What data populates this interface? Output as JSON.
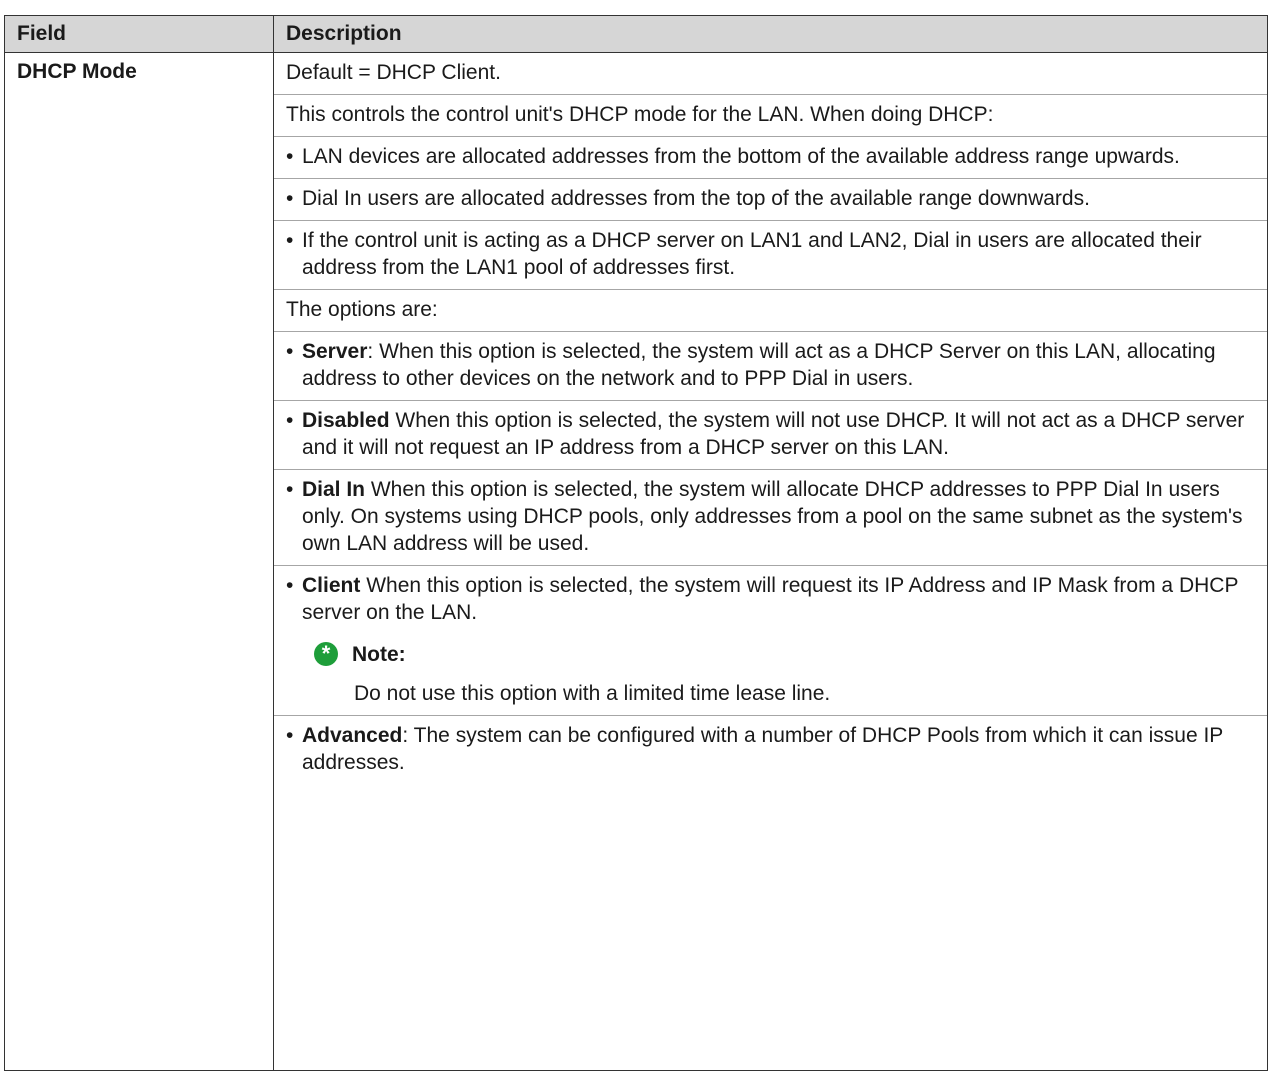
{
  "header": {
    "field": "Field",
    "description": "Description"
  },
  "row": {
    "field": "DHCP Mode",
    "default": "Default = DHCP Client.",
    "intro": "This controls the control unit's DHCP mode for the LAN. When doing DHCP:",
    "dhcp_bullets": [
      "LAN devices are allocated addresses from the bottom of the available address range upwards.",
      "Dial In users are allocated addresses from the top of the available range downwards.",
      "If the control unit is acting as a DHCP server on LAN1 and LAN2, Dial in users are allocated their address from the LAN1 pool of addresses first."
    ],
    "options_intro": "The options are:",
    "options": [
      {
        "term": "Server",
        "sep": ": ",
        "text": "When this option is selected, the system will act as a DHCP Server on this LAN, allocating address to other devices on the network and to PPP Dial in users."
      },
      {
        "term": "Disabled",
        "sep": " ",
        "text": "When this option is selected, the system will not use DHCP. It will not act as a DHCP server and it will not request an IP address from a DHCP server on this LAN."
      },
      {
        "term": "Dial In",
        "sep": " ",
        "text": "When this option is selected, the system will allocate DHCP addresses to PPP Dial In users only. On systems using DHCP pools, only addresses from a pool on the same subnet as the system's own LAN address will be used."
      },
      {
        "term": "Client",
        "sep": " ",
        "text": "When this option is selected, the system will request its IP Address and IP Mask from a DHCP server on the LAN."
      }
    ],
    "note": {
      "icon": "note-star-icon",
      "label": "Note:",
      "text": "Do not use this option with a limited time lease line."
    },
    "advanced": {
      "term": "Advanced",
      "sep": ": ",
      "text": "The system can be configured with a number of DHCP Pools from which it can issue IP addresses."
    },
    "bullet_char": "•",
    "note_glyph": "*"
  },
  "colors": {
    "header_bg": "#d6d6d6",
    "note_icon": "#1e9e3a",
    "border": "#333333"
  }
}
